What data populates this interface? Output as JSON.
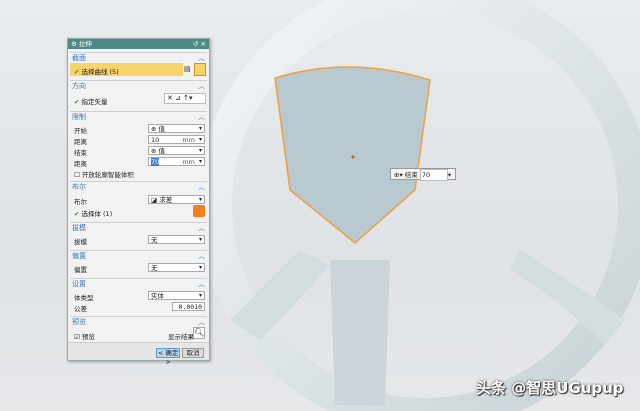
{
  "dialog": {
    "title": "拉伸",
    "section": {
      "title": "截面",
      "select_curve": "选择曲线 (5)"
    },
    "direction": {
      "title": "方向",
      "specify_vector": "指定矢量"
    },
    "limits": {
      "title": "限制",
      "start_label": "开始",
      "start_value": "值",
      "dist1_label": "距离",
      "dist1_value": "10",
      "dist1_unit": "mm",
      "end_label": "结束",
      "end_value": "值",
      "dist2_label": "距离",
      "dist2_value": "70",
      "dist2_unit": "mm",
      "open_profile": "开放轮廓智能体积"
    },
    "boolean": {
      "title": "布尔",
      "label": "布尔",
      "value": "求差",
      "select_body": "选择体 (1)"
    },
    "draft": {
      "title": "拔模",
      "label": "拔模",
      "value": "无"
    },
    "offset": {
      "title": "偏置",
      "label": "偏置",
      "value": "无"
    },
    "settings": {
      "title": "设置",
      "body_type_label": "体类型",
      "body_type_value": "实体",
      "tolerance_label": "公差",
      "tolerance_value": "0.0010"
    },
    "preview": {
      "title": "预览",
      "preview_label": "预览",
      "show_result": "显示结果"
    },
    "ok": "< 确定 >",
    "cancel": "取消"
  },
  "floating": {
    "label": "结束",
    "value": "70"
  },
  "watermark": "头条 @智思UGupup",
  "colors": {
    "accent": "#4d8a86",
    "highlight": "#f7d36a",
    "edge": "#f0a040"
  }
}
